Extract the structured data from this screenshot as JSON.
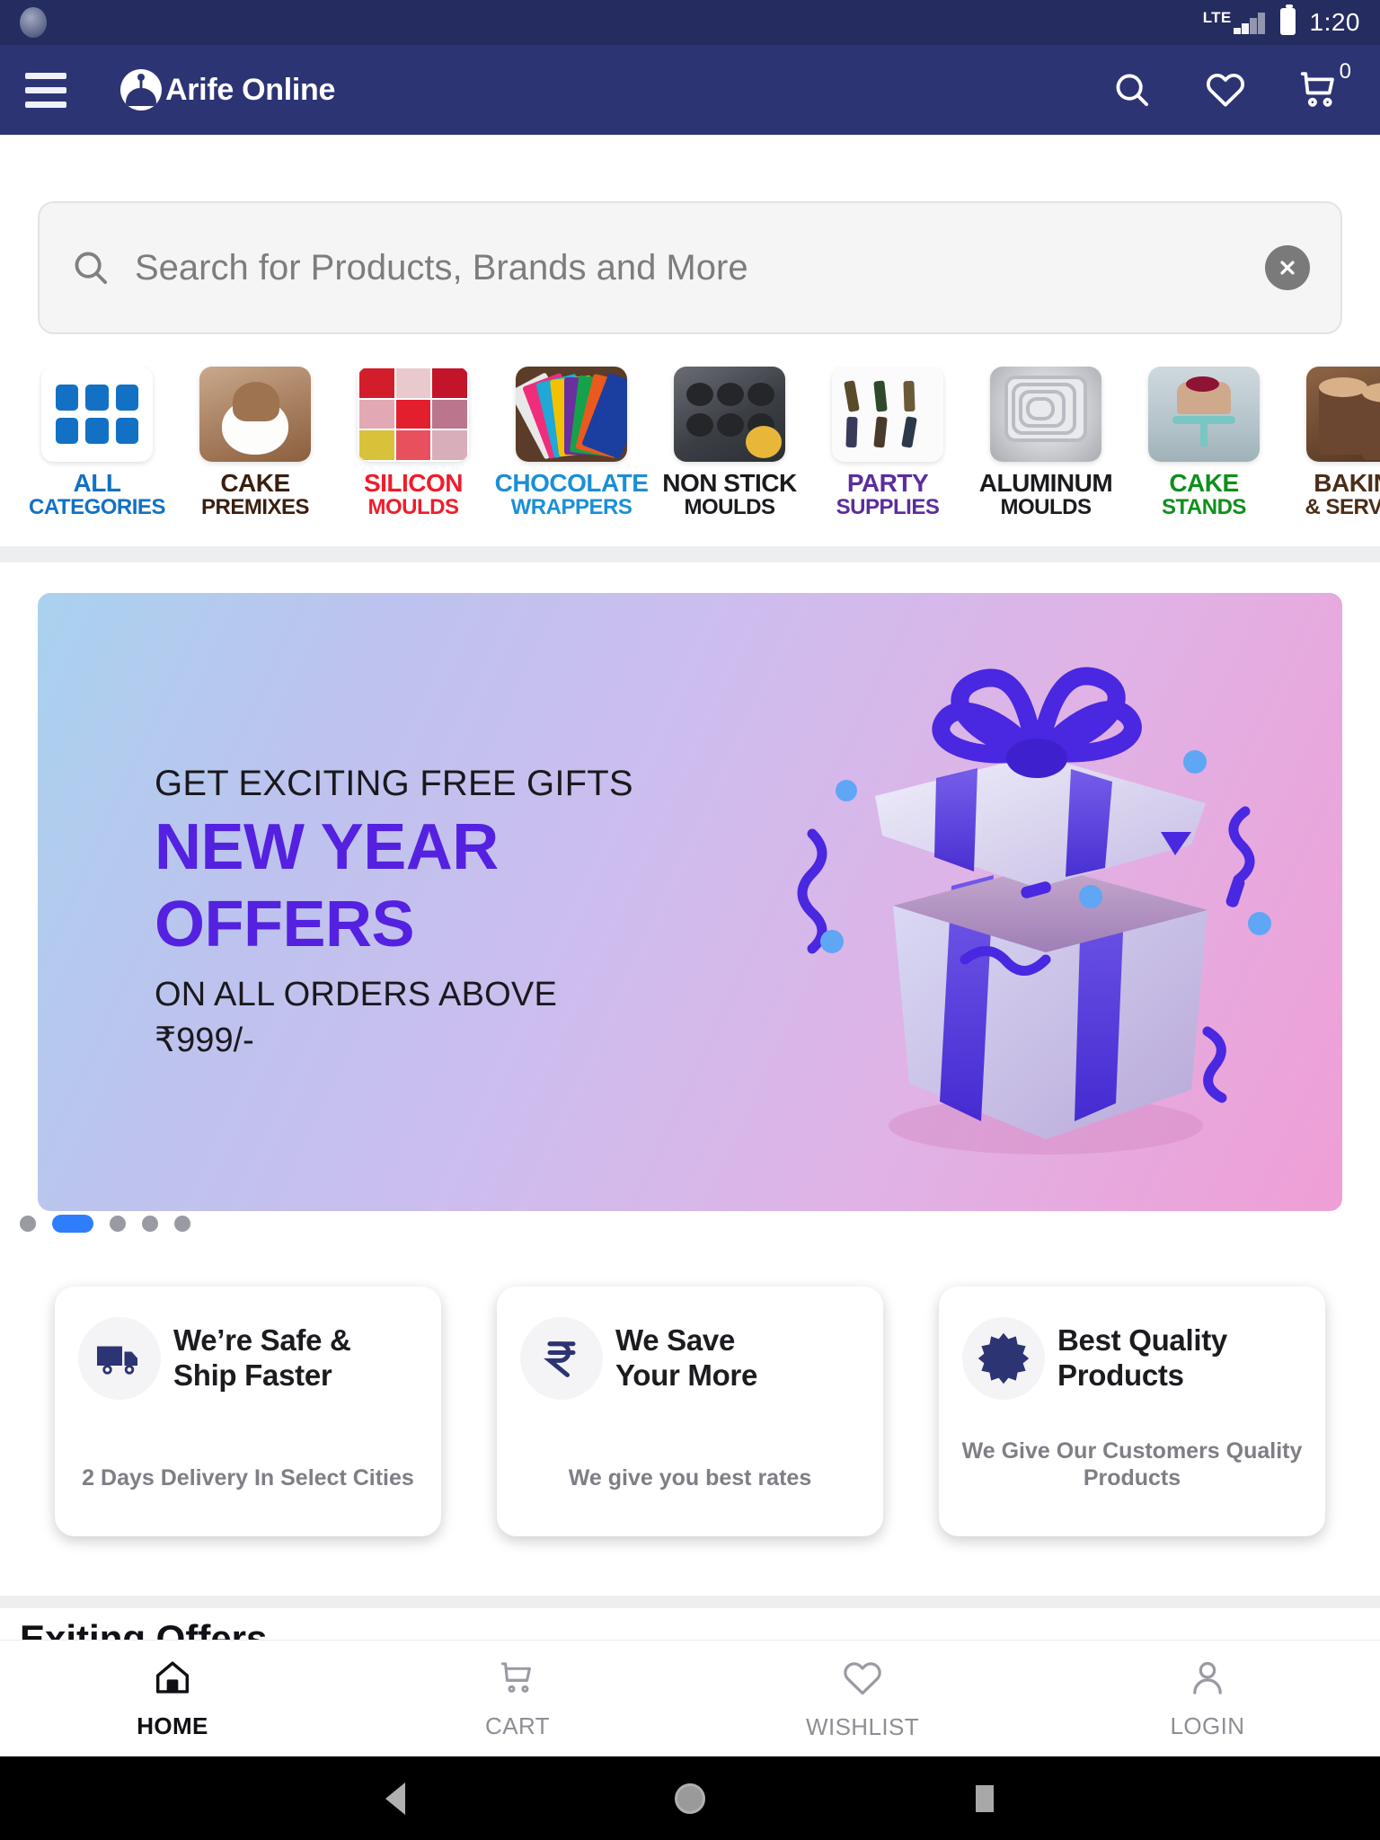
{
  "status_bar": {
    "network_label": "LTE",
    "time": "1:20"
  },
  "app_bar": {
    "menu_icon": "hamburger-menu-icon",
    "brand_name": "Arife Online",
    "search_icon": "search-icon",
    "wishlist_icon": "heart-icon",
    "cart_icon": "shopping-cart-icon",
    "cart_count": "0",
    "background_color": "#2c3473"
  },
  "search": {
    "placeholder": "Search for Products, Brands and More",
    "value": "",
    "search_icon": "search-icon",
    "clear_icon": "close-circle-icon"
  },
  "categories": [
    {
      "line1": "ALL",
      "line2": "CATEGORIES",
      "color1": "#1271c4",
      "color2": "#1271c4",
      "art": "a-all"
    },
    {
      "line1": "CAKE",
      "line2": "PREMIXES",
      "color1": "#3a1f10",
      "color2": "#3a1f10",
      "art": "a-premix"
    },
    {
      "line1": "SILICON",
      "line2": "MOULDS",
      "color1": "#ef1d2b",
      "color2": "#ef1d2b",
      "art": "a-silicon"
    },
    {
      "line1": "CHOCOLATE",
      "line2": "WRAPPERS",
      "color1": "#1b8fd6",
      "color2": "#1b8fd6",
      "art": "a-wrap"
    },
    {
      "line1": "NON STICK",
      "line2": "MOULDS",
      "color1": "#1b1b1f",
      "color2": "#1b1b1f",
      "art": "a-nonstick"
    },
    {
      "line1": "PARTY",
      "line2": "SUPPLIES",
      "color1": "#5b2d9b",
      "color2": "#5b2d9b",
      "art": "a-party"
    },
    {
      "line1": "ALUMINUM",
      "line2": "MOULDS",
      "color1": "#1b1b1f",
      "color2": "#1b1b1f",
      "art": "a-alu"
    },
    {
      "line1": "CAKE",
      "line2": "STANDS",
      "color1": "#0f8f1c",
      "color2": "#0f8f1c",
      "art": "a-stand"
    },
    {
      "line1": "BAKING",
      "line2": "& SERVING",
      "color1": "#4b2d18",
      "color2": "#4b2d18",
      "art": "a-bake"
    }
  ],
  "hero": {
    "kicker": "GET EXCITING FREE GIFTS",
    "headline_line1": "NEW YEAR",
    "headline_line2": "OFFERS",
    "subline": "ON ALL ORDERS ABOVE",
    "amount": "₹999/-",
    "accent_color": "#5421e0",
    "image": "gift-box-illustration"
  },
  "carousel": {
    "total_dots": 5,
    "active_index": 1,
    "active_color": "#2e7dfa"
  },
  "features": [
    {
      "icon": "delivery-truck-icon",
      "title_line1": "We’re Safe &",
      "title_line2": "Ship Faster",
      "subtitle": "2 Days Delivery In Select Cities"
    },
    {
      "icon": "rupee-icon",
      "title_line1": "We Save",
      "title_line2": "Your More",
      "subtitle": "We give you best rates"
    },
    {
      "icon": "quality-badge-icon",
      "title_line1": "Best Quality",
      "title_line2": "Products",
      "subtitle": "We Give Our Customers Quality Products"
    }
  ],
  "offers_section": {
    "title": "Exiting Offers"
  },
  "bottom_nav": [
    {
      "icon": "home-icon",
      "label": "HOME",
      "active": true
    },
    {
      "icon": "cart-icon",
      "label": "CART",
      "active": false
    },
    {
      "icon": "heart-icon",
      "label": "WISHLIST",
      "active": false
    },
    {
      "icon": "person-icon",
      "label": "LOGIN",
      "active": false
    }
  ],
  "android_nav": {
    "back_icon": "back-triangle-icon",
    "home_icon": "home-circle-icon",
    "recents_icon": "recents-square-icon"
  }
}
